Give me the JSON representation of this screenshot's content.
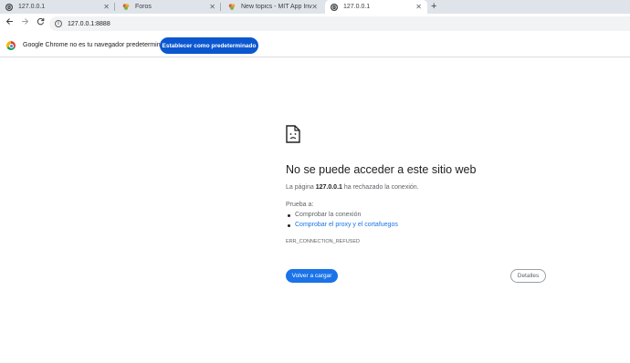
{
  "tabs": [
    {
      "title": "127.0.0.1",
      "icon": "globe-icon",
      "active": false
    },
    {
      "title": "Foros",
      "icon": "mit-app-inventor-icon",
      "active": false
    },
    {
      "title": "New topics - MIT App Inventor",
      "icon": "mit-app-inventor-icon",
      "active": false
    },
    {
      "title": "127.0.0.1",
      "icon": "globe-icon",
      "active": true
    }
  ],
  "toolbar": {
    "url": "127.0.0.1:8888"
  },
  "infobar": {
    "message": "Google Chrome no es tu navegador predeterminado",
    "button": "Establecer como predeterminado"
  },
  "error": {
    "title": "No se puede acceder a este sitio web",
    "desc_prefix": "La página",
    "host": "127.0.0.1",
    "desc_suffix": "ha rechazado la conexión.",
    "try_label": "Prueba a:",
    "suggestions": [
      "Comprobar la conexión",
      "Comprobar el proxy y el cortafuegos"
    ],
    "code": "ERR_CONNECTION_REFUSED",
    "reload_button": "Volver a cargar",
    "details_button": "Detalles"
  },
  "colors": {
    "accent": "#1a73e8",
    "infobar_button": "#0b57d0",
    "tabstrip": "#dfe3ea"
  }
}
